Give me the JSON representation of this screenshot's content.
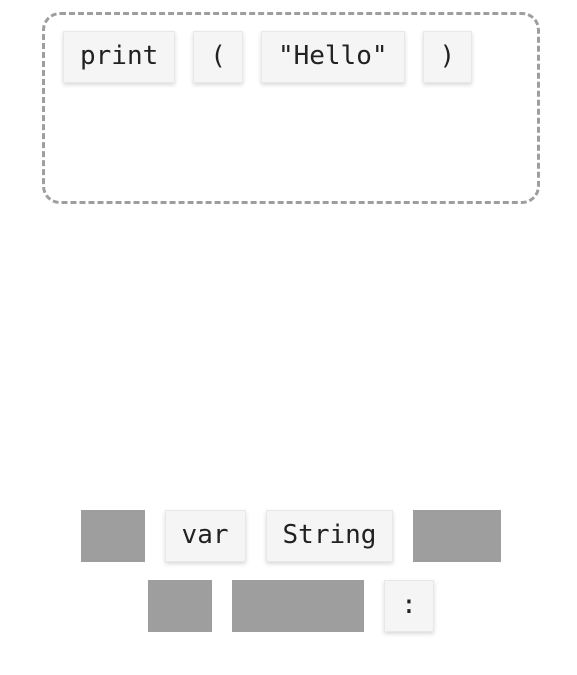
{
  "dropzone": {
    "tokens": [
      {
        "label": "print"
      },
      {
        "label": "("
      },
      {
        "label": "\"Hello\""
      },
      {
        "label": ")"
      }
    ]
  },
  "tray": {
    "row1": [
      {
        "kind": "placeholder",
        "size": "small"
      },
      {
        "kind": "token",
        "label": "var"
      },
      {
        "kind": "token",
        "label": "String"
      },
      {
        "kind": "placeholder",
        "size": "med"
      }
    ],
    "row2": [
      {
        "kind": "placeholder",
        "size": "small"
      },
      {
        "kind": "placeholder",
        "size": "wide"
      },
      {
        "kind": "token",
        "label": ":"
      }
    ]
  }
}
